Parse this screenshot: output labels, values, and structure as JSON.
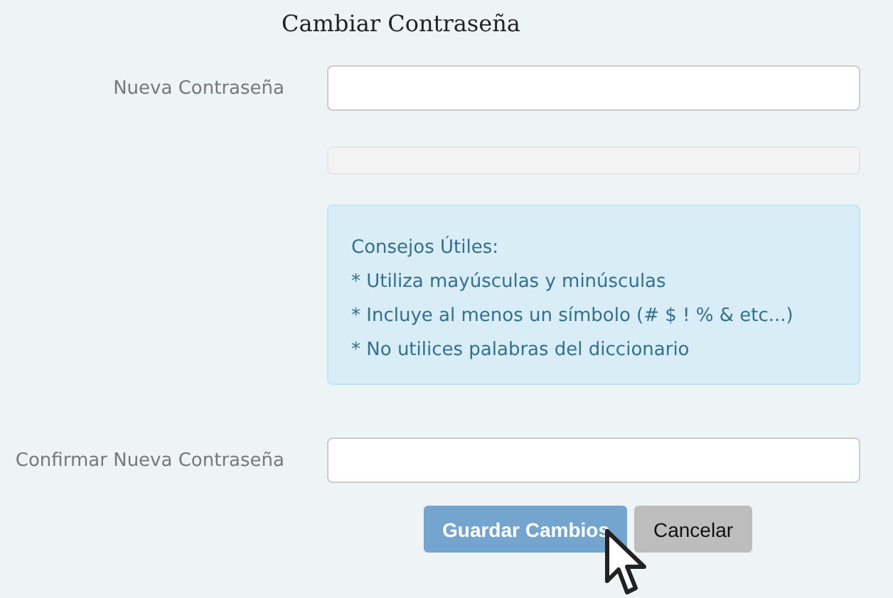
{
  "title": "Cambiar Contraseña",
  "new_password": {
    "label": "Nueva Contraseña"
  },
  "strength_meter": {
    "level": 0
  },
  "tips": {
    "heading": "Consejos Útiles:",
    "items": [
      "* Utiliza mayúsculas y minúsculas",
      "* Incluye al menos un símbolo (# $ ! % & etc...)",
      "* No utilices palabras del diccionario"
    ]
  },
  "confirm_password": {
    "label": "Confirmar Nueva Contraseña"
  },
  "buttons": [
    {
      "label": "Guardar Cambios",
      "kind": "primary"
    },
    {
      "label": "Cancelar",
      "kind": "secondary"
    }
  ]
}
